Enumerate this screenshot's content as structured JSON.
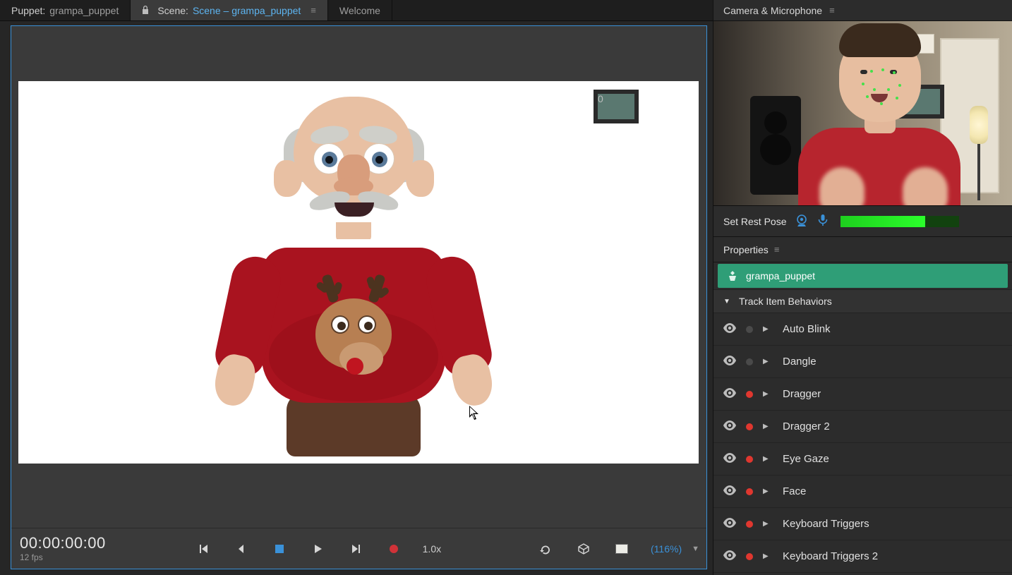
{
  "tabs": {
    "puppet_prefix": "Puppet:",
    "puppet_name": "grampa_puppet",
    "scene_prefix": "Scene:",
    "scene_name": "Scene – grampa_puppet",
    "welcome": "Welcome"
  },
  "transport": {
    "timecode": "00:00:00:00",
    "frame": "0",
    "fps": "12 fps",
    "speed": "1.0x",
    "zoom": "(116%)"
  },
  "side": {
    "camera_panel_title": "Camera & Microphone",
    "set_rest_pose": "Set Rest Pose",
    "properties_title": "Properties",
    "selected_item": "grampa_puppet",
    "section_title": "Track Item Behaviors",
    "behaviors": [
      {
        "name": "Auto Blink",
        "armed": false
      },
      {
        "name": "Dangle",
        "armed": false
      },
      {
        "name": "Dragger",
        "armed": true
      },
      {
        "name": "Dragger 2",
        "armed": true
      },
      {
        "name": "Eye Gaze",
        "armed": true
      },
      {
        "name": "Face",
        "armed": true
      },
      {
        "name": "Keyboard Triggers",
        "armed": true
      },
      {
        "name": "Keyboard Triggers 2",
        "armed": true
      }
    ]
  },
  "icons": {
    "menu": "≡"
  }
}
